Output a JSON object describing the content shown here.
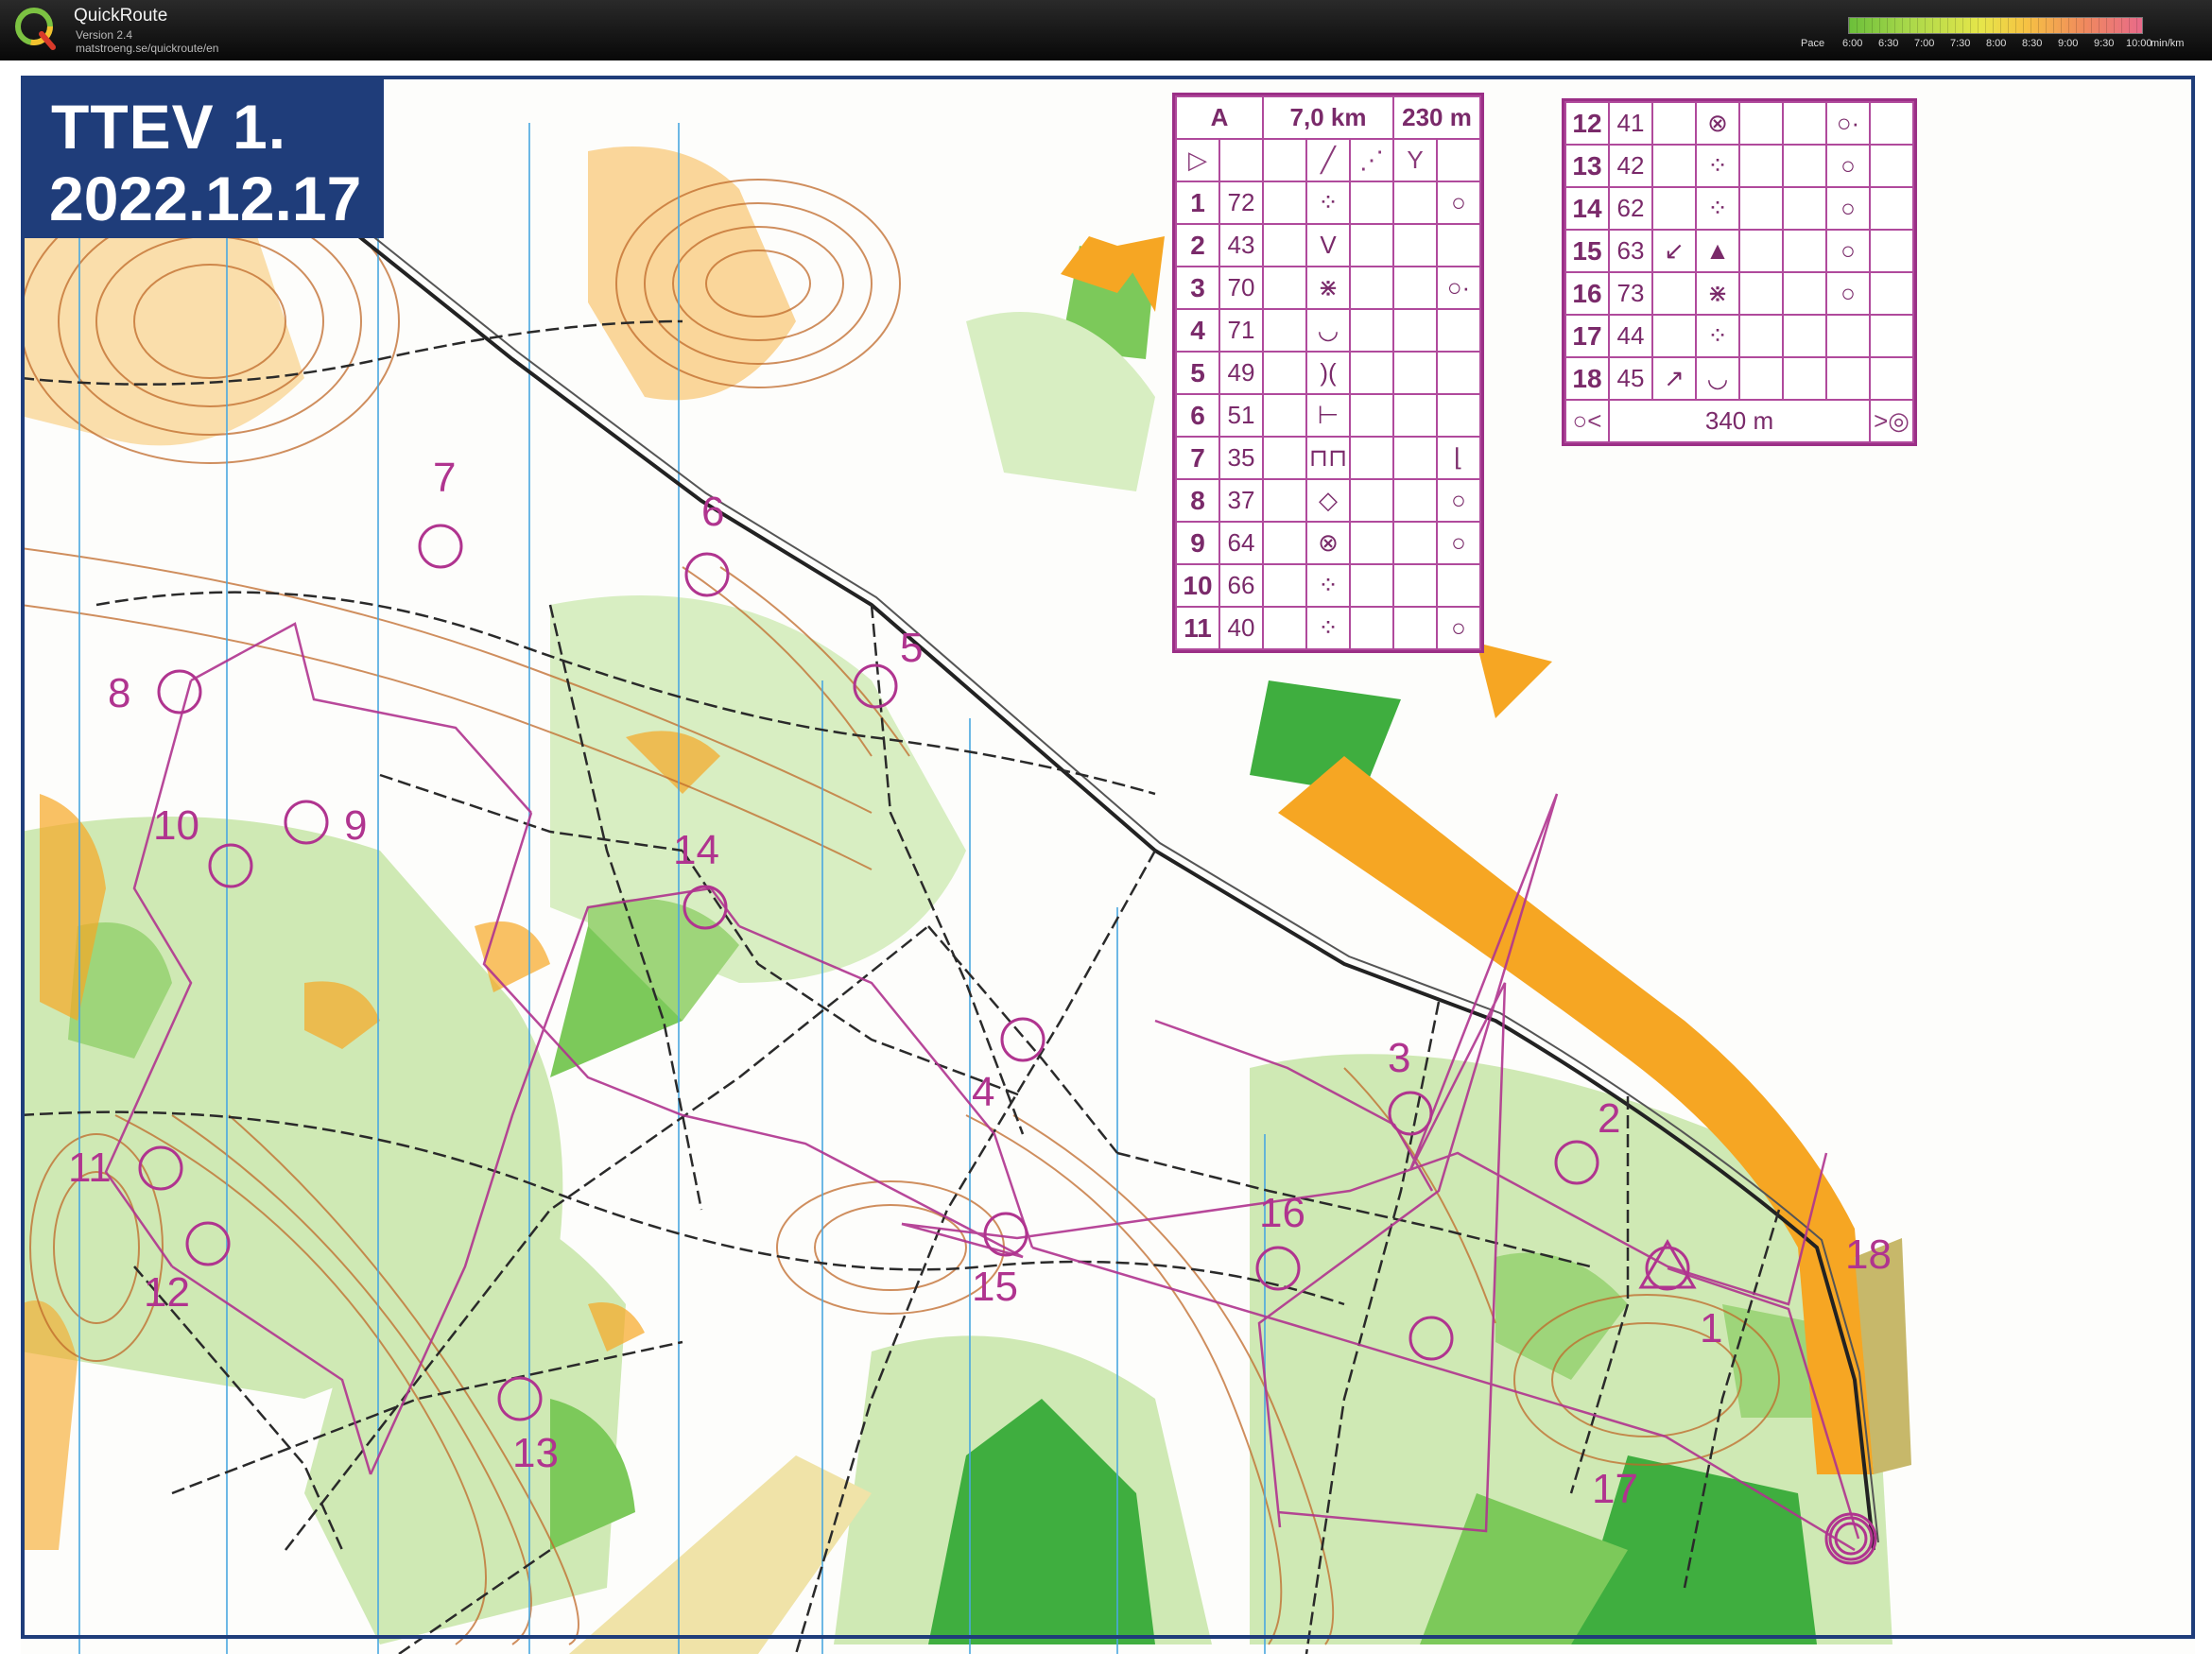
{
  "app": {
    "name": "QuickRoute",
    "version": "Version 2.4",
    "url": "matstroeng.se/quickroute/en"
  },
  "pace_legend": {
    "label": "Pace",
    "ticks": [
      "6:00",
      "6:30",
      "7:00",
      "7:30",
      "8:00",
      "8:30",
      "9:00",
      "9:30",
      "10:00"
    ],
    "unit": "min/km"
  },
  "map_title": {
    "line1": "TTEV 1.",
    "line2": "2022.12.17"
  },
  "course": {
    "class": "A",
    "length": "7,0 km",
    "climb": "230 m",
    "finish_distance": "340 m"
  },
  "controls_left": [
    {
      "num": "1",
      "code": "72",
      "symbol": "⁘",
      "extra": "○"
    },
    {
      "num": "2",
      "code": "43",
      "symbol": "V",
      "extra": ""
    },
    {
      "num": "3",
      "code": "70",
      "symbol": "⋇",
      "extra": "○·"
    },
    {
      "num": "4",
      "code": "71",
      "symbol": "◡",
      "extra": ""
    },
    {
      "num": "5",
      "code": "49",
      "symbol": ")(",
      "extra": ""
    },
    {
      "num": "6",
      "code": "51",
      "symbol": "⊢",
      "extra": ""
    },
    {
      "num": "7",
      "code": "35",
      "symbol": "⊓⊓",
      "extra": "⌊"
    },
    {
      "num": "8",
      "code": "37",
      "symbol": "◇",
      "extra": "○"
    },
    {
      "num": "9",
      "code": "64",
      "symbol": "⊗",
      "extra": "○"
    },
    {
      "num": "10",
      "code": "66",
      "symbol": "⁘",
      "extra": ""
    },
    {
      "num": "11",
      "code": "40",
      "symbol": "⁘",
      "extra": "○"
    }
  ],
  "controls_right": [
    {
      "num": "12",
      "code": "41",
      "dir": "",
      "symbol": "⊗",
      "extra": "○·"
    },
    {
      "num": "13",
      "code": "42",
      "dir": "",
      "symbol": "⁘",
      "extra": "○"
    },
    {
      "num": "14",
      "code": "62",
      "dir": "",
      "symbol": "⁘",
      "extra": "○"
    },
    {
      "num": "15",
      "code": "63",
      "dir": "↙",
      "symbol": "▲",
      "extra": "○"
    },
    {
      "num": "16",
      "code": "73",
      "dir": "",
      "symbol": "⋇",
      "extra": "○"
    },
    {
      "num": "17",
      "code": "44",
      "dir": "",
      "symbol": "⁘",
      "extra": ""
    },
    {
      "num": "18",
      "code": "45",
      "dir": "↗",
      "symbol": "◡",
      "extra": ""
    }
  ],
  "map_controls": [
    {
      "label": "1"
    },
    {
      "label": "2"
    },
    {
      "label": "3"
    },
    {
      "label": "4"
    },
    {
      "label": "5"
    },
    {
      "label": "6"
    },
    {
      "label": "7"
    },
    {
      "label": "8"
    },
    {
      "label": "9"
    },
    {
      "label": "10"
    },
    {
      "label": "11"
    },
    {
      "label": "12"
    },
    {
      "label": "13"
    },
    {
      "label": "14"
    },
    {
      "label": "15"
    },
    {
      "label": "16"
    },
    {
      "label": "17"
    },
    {
      "label": "18"
    }
  ],
  "colors": {
    "overprint": "#b0348f",
    "map_blue_frame": "#1f3d7a",
    "forest_light": "#c8e6a8",
    "forest_dark": "#3fae3f",
    "open_land": "#f6a623",
    "contour": "#c06a2a"
  }
}
